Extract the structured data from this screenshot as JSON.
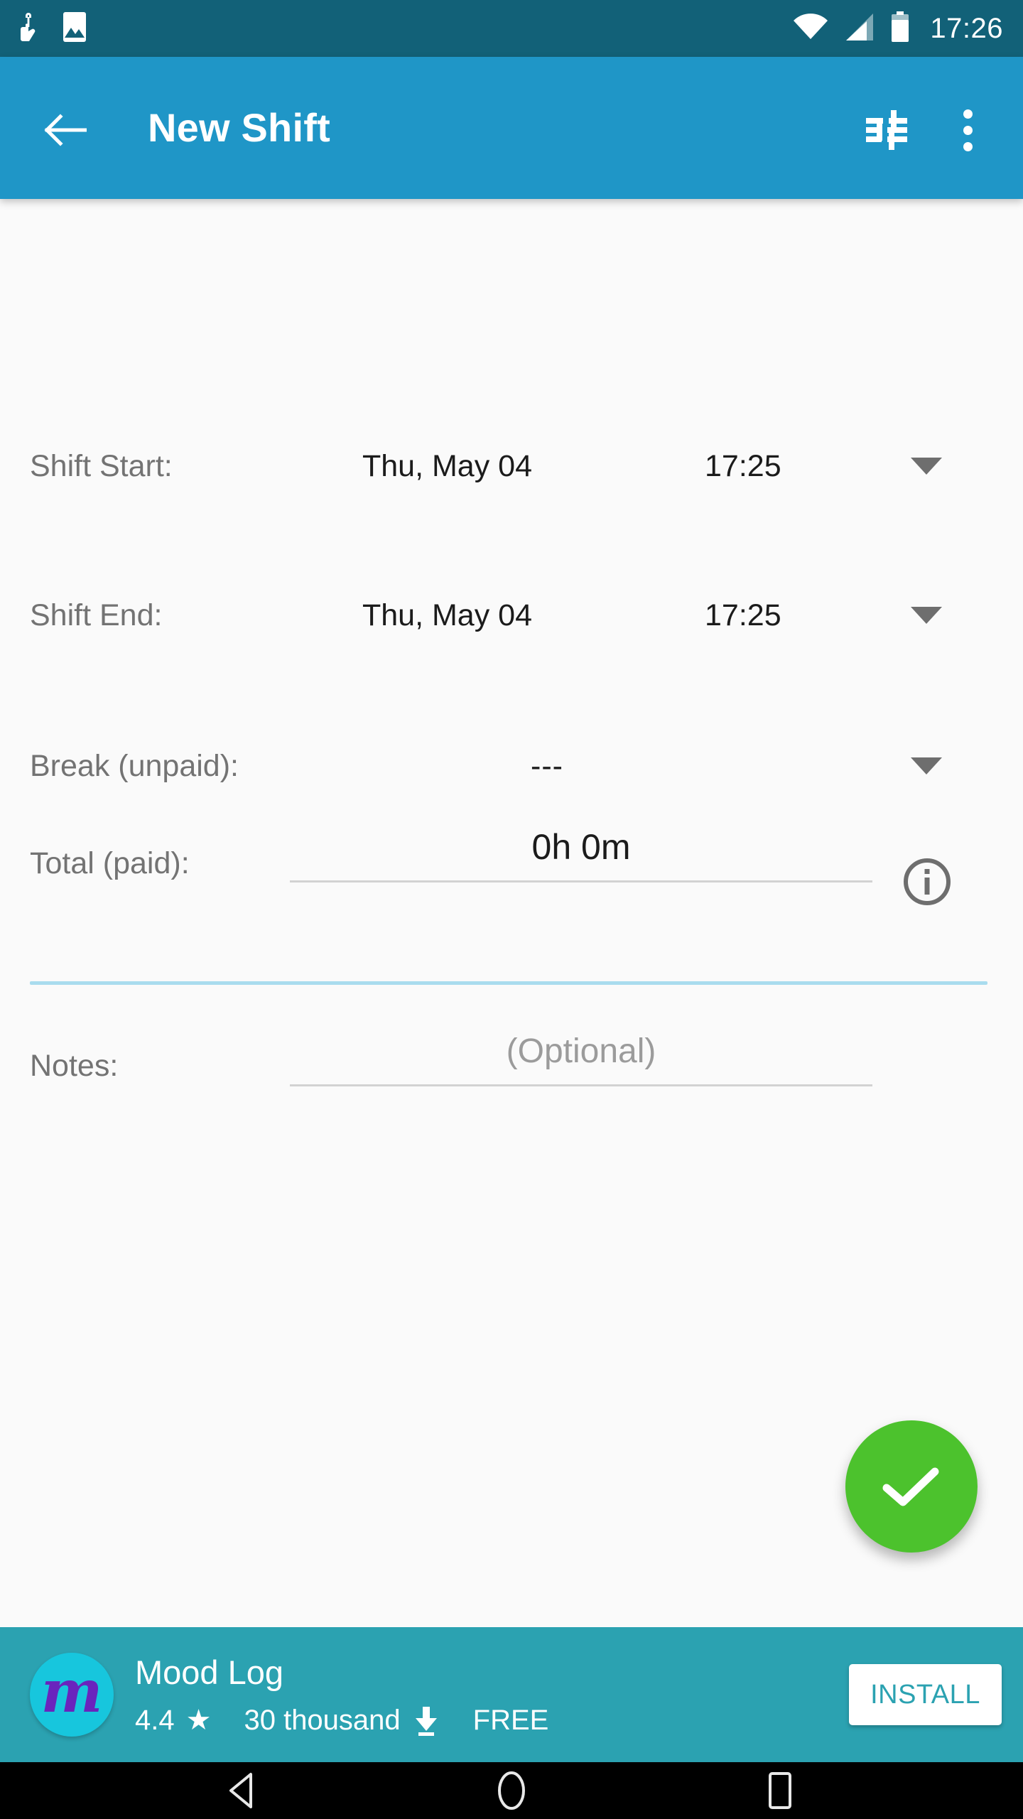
{
  "status_bar": {
    "icons": [
      "touch-pointer-icon",
      "image-icon",
      "wifi-icon",
      "cellular-signal-icon",
      "battery-icon"
    ],
    "time": "17:26",
    "background_color": "#126178"
  },
  "app_bar": {
    "back_label": "back-arrow-icon",
    "title": "New Shift",
    "tune_label": "tune-icon",
    "overflow_label": "more-options-icon",
    "background_color": "#1f96c7"
  },
  "form": {
    "rows": [
      {
        "label": "Shift Start:",
        "date": "Thu, May 04",
        "time": "17:25"
      },
      {
        "label": "Shift End:",
        "date": "Thu, May 04",
        "time": "17:25"
      }
    ],
    "break": {
      "label": "Break (unpaid):",
      "value": "---"
    },
    "total": {
      "label": "Total (paid):",
      "value": "0h 0m",
      "info_icon": "info-icon"
    },
    "notes": {
      "label": "Notes:",
      "value": "",
      "placeholder": "(Optional)"
    }
  },
  "fab": {
    "icon": "check-icon",
    "color": "#4cc22d"
  },
  "ad": {
    "app_name": "Mood Log",
    "rating": "4.4",
    "star": "★",
    "downloads": "30 thousand",
    "download_icon": "download-icon",
    "price": "FREE",
    "install_label": "INSTALL",
    "icon_letter": "m",
    "background_color": "#2ba2b1"
  },
  "nav_bar": {
    "back": "nav-back-icon",
    "home": "nav-home-icon",
    "recent": "nav-recent-icon"
  }
}
